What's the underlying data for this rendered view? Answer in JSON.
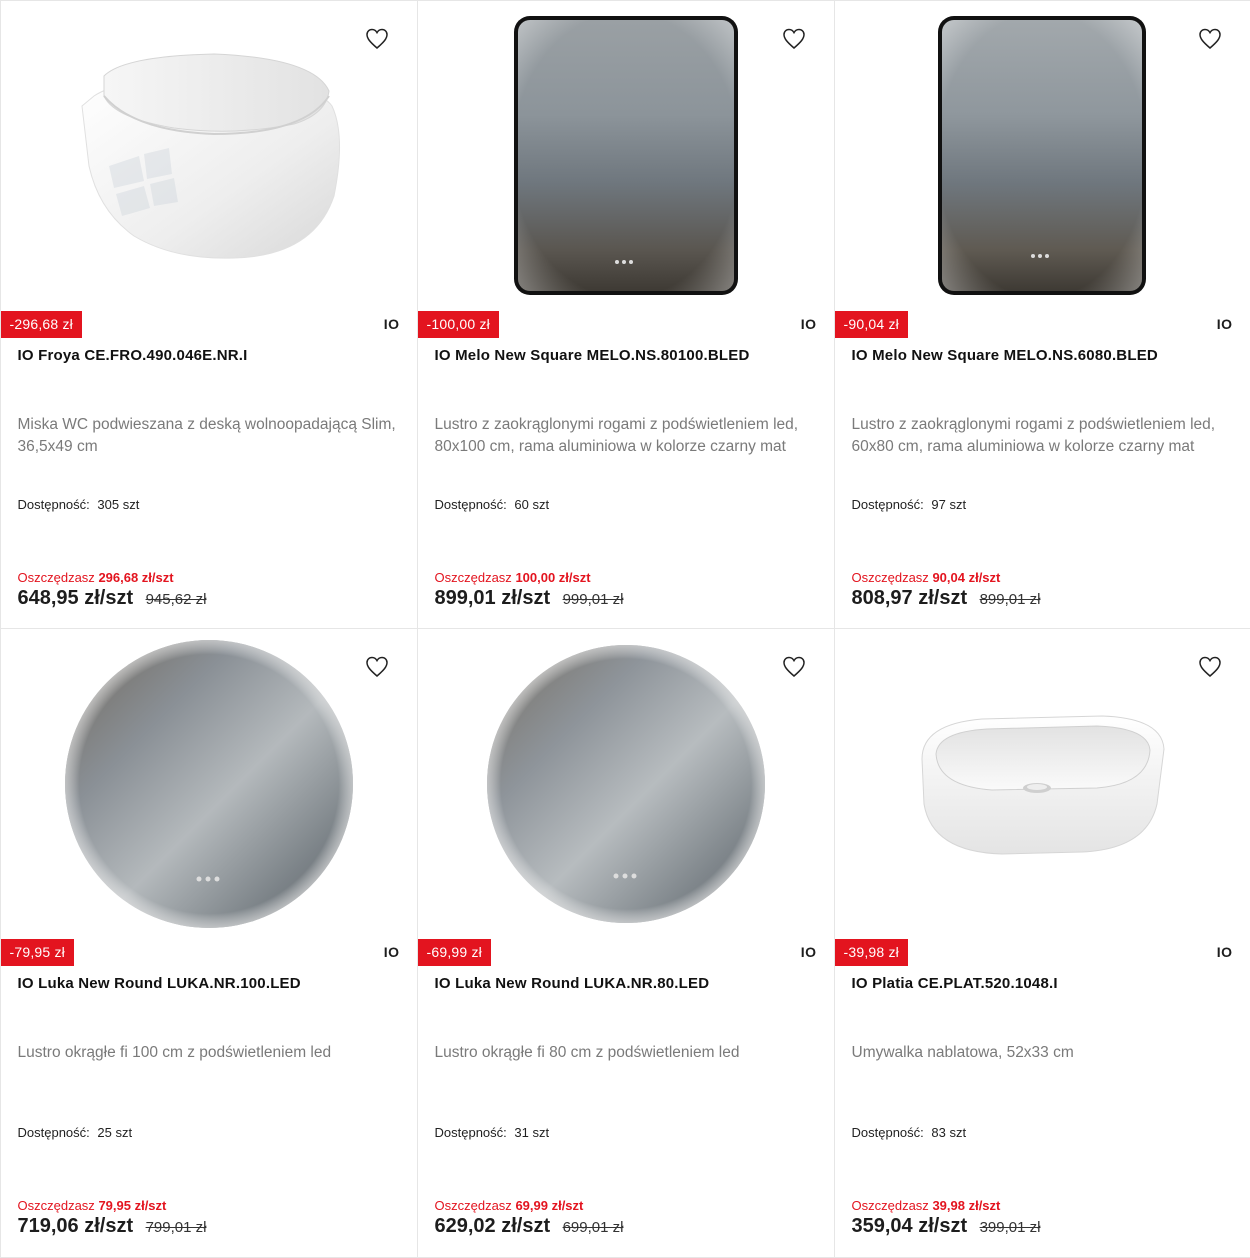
{
  "products": [
    {
      "id_label": "toilet",
      "discount": "-296,68 zł",
      "brand": "IO",
      "title": "IO Froya CE.FRO.490.046E.NR.I",
      "description": "Miska WC podwieszana z deską wolnoopadającą Slim, 36,5x49 cm",
      "availability_label": "Dostępność:",
      "availability_value": "305 szt",
      "save_label": "Oszczędzasz",
      "save_amount": "296,68 zł/szt",
      "price": "648,95 zł/szt",
      "old_price": "945,62 zł",
      "icon": "wall-hung-toilet-image"
    },
    {
      "id_label": "mirror-rect-80",
      "discount": "-100,00 zł",
      "brand": "IO",
      "title": "IO Melo New Square MELO.NS.80100.BLED",
      "description": "Lustro z zaokrąglonymi rogami z podświetleniem led, 80x100 cm, rama aluminiowa w kolorze czarny mat",
      "availability_label": "Dostępność:",
      "availability_value": "60 szt",
      "save_label": "Oszczędzasz",
      "save_amount": "100,00 zł/szt",
      "price": "899,01 zł/szt",
      "old_price": "999,01 zł",
      "icon": "rect-mirror-image"
    },
    {
      "id_label": "mirror-rect-60",
      "discount": "-90,04 zł",
      "brand": "IO",
      "title": "IO Melo New Square MELO.NS.6080.BLED",
      "description": "Lustro z zaokrąglonymi rogami z podświetleniem led, 60x80 cm, rama aluminiowa w kolorze czarny mat",
      "availability_label": "Dostępność:",
      "availability_value": "97 szt",
      "save_label": "Oszczędzasz",
      "save_amount": "90,04 zł/szt",
      "price": "808,97 zł/szt",
      "old_price": "899,01 zł",
      "icon": "rect-mirror-image"
    },
    {
      "id_label": "mirror-round-100",
      "discount": "-79,95 zł",
      "brand": "IO",
      "title": "IO Luka New Round LUKA.NR.100.LED",
      "description": "Lustro okrągłe fi 100 cm z podświetleniem led",
      "availability_label": "Dostępność:",
      "availability_value": "25 szt",
      "save_label": "Oszczędzasz",
      "save_amount": "79,95 zł/szt",
      "price": "719,06 zł/szt",
      "old_price": "799,01 zł",
      "icon": "round-mirror-image"
    },
    {
      "id_label": "mirror-round-80",
      "discount": "-69,99 zł",
      "brand": "IO",
      "title": "IO Luka New Round LUKA.NR.80.LED",
      "description": "Lustro okrągłe fi 80 cm z podświetleniem led",
      "availability_label": "Dostępność:",
      "availability_value": "31 szt",
      "save_label": "Oszczędzasz",
      "save_amount": "69,99 zł/szt",
      "price": "629,02 zł/szt",
      "old_price": "699,01 zł",
      "icon": "round-mirror-image"
    },
    {
      "id_label": "washbasin",
      "discount": "-39,98 zł",
      "brand": "IO",
      "title": "IO Platia CE.PLAT.520.1048.I",
      "description": "Umywalka nablatowa, 52x33 cm",
      "availability_label": "Dostępność:",
      "availability_value": "83 szt",
      "save_label": "Oszczędzasz",
      "save_amount": "39,98 zł/szt",
      "price": "359,04 zł/szt",
      "old_price": "399,01 zł",
      "icon": "washbasin-image"
    }
  ],
  "colors": {
    "accent_red": "#e3141f",
    "text_dark": "#1d1d1d",
    "text_muted": "#7a7a7a",
    "border": "#e6e6e6"
  },
  "icons": {
    "favorite": "heart-outline-icon"
  }
}
